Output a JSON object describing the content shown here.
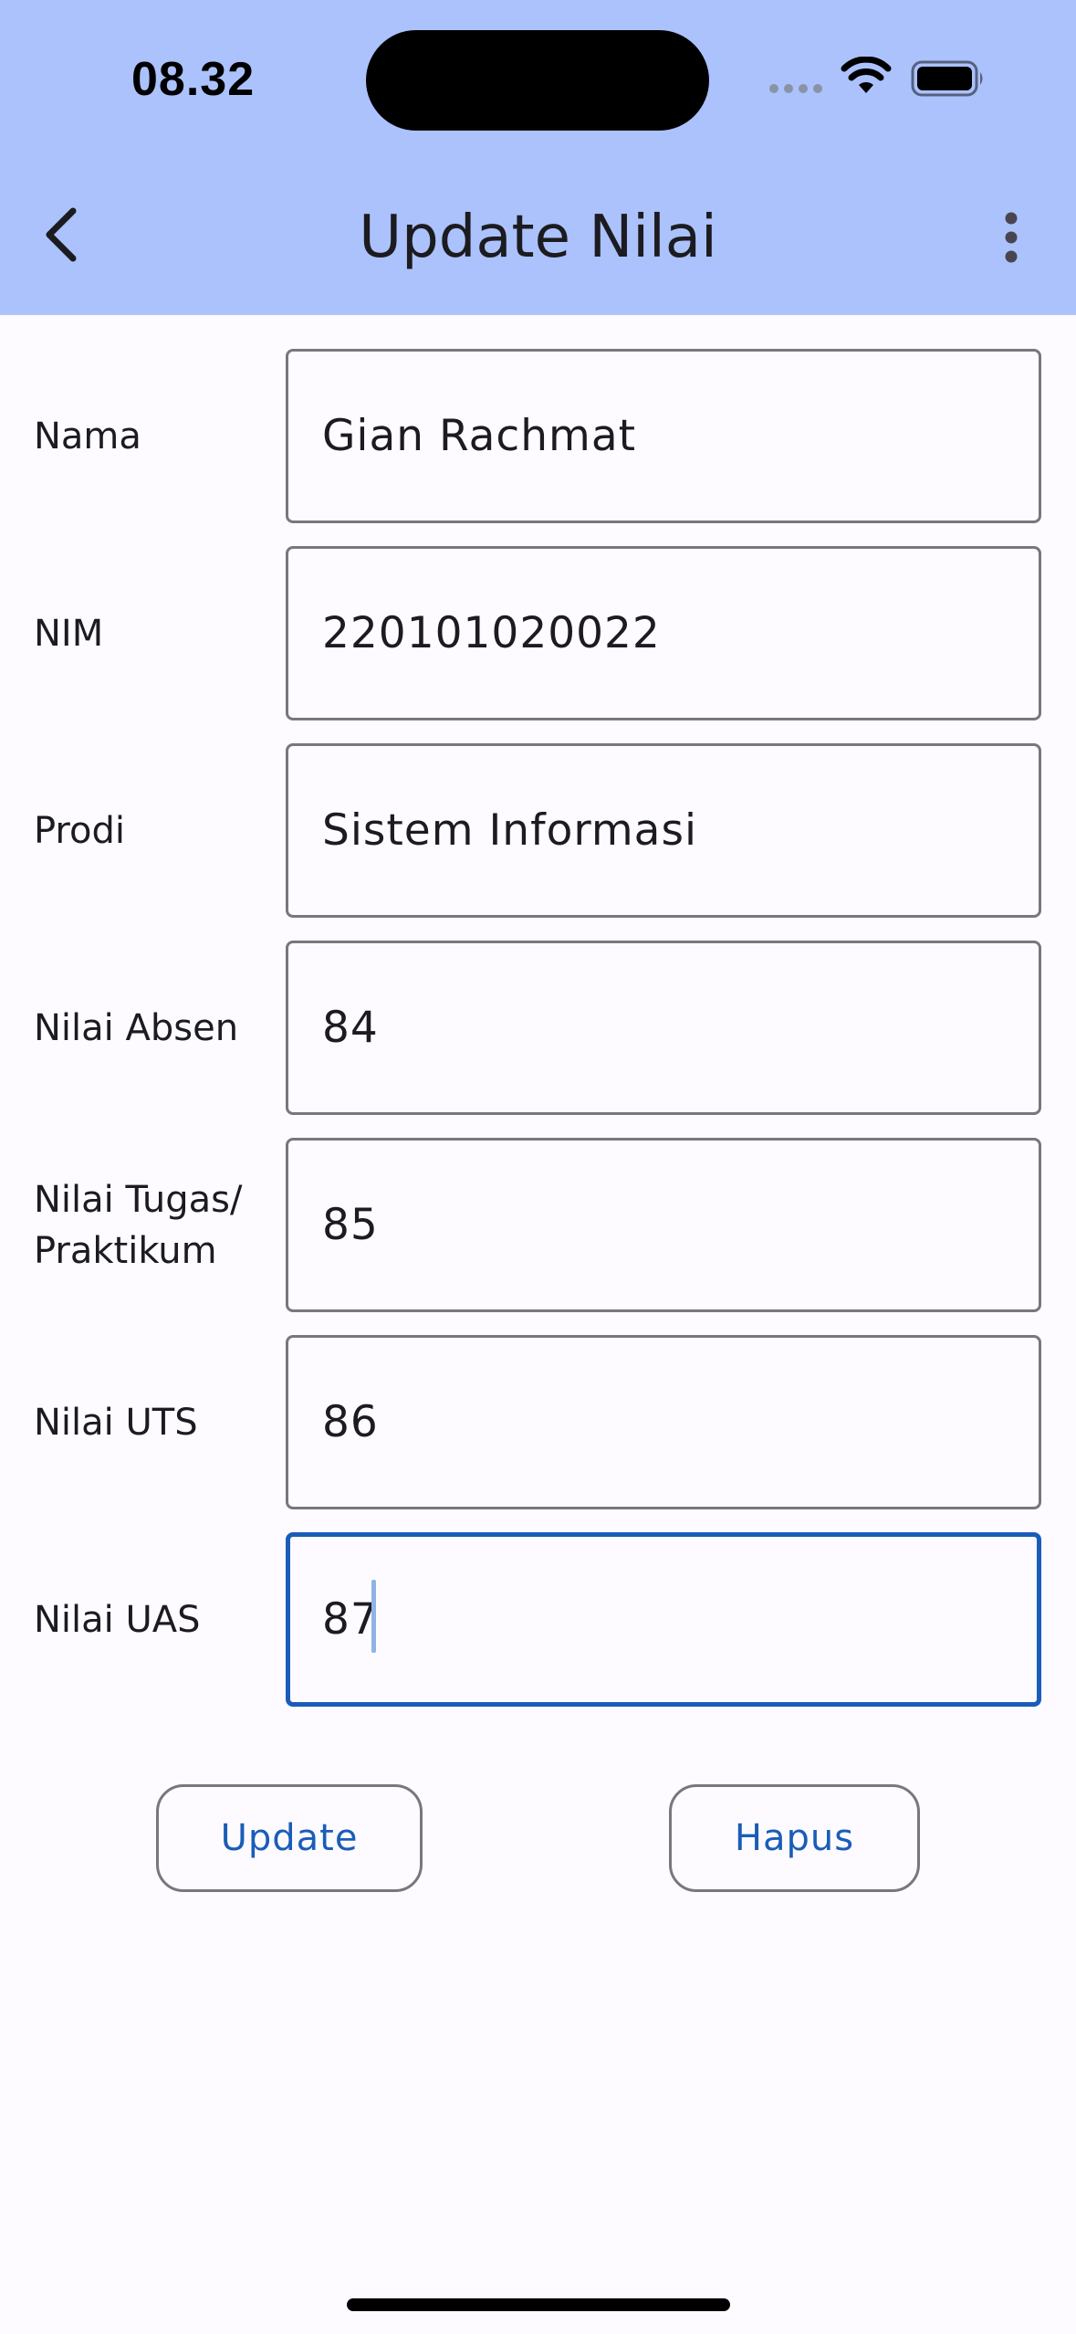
{
  "status_bar": {
    "time": "08.32",
    "icons": [
      "signal-dots-icon",
      "wifi-icon",
      "battery-icon"
    ]
  },
  "app_bar": {
    "title": "Update Nilai",
    "back_icon": "chevron-left-icon",
    "menu_icon": "more-vertical-icon",
    "background": "#ABC2FC"
  },
  "form": {
    "fields": [
      {
        "label": "Nama",
        "value": "Gian Rachmat"
      },
      {
        "label": "NIM",
        "value": "220101020022"
      },
      {
        "label": "Prodi",
        "value": "Sistem Informasi"
      },
      {
        "label": "Nilai Absen",
        "value": "84"
      },
      {
        "label": "Nilai Tugas/\nPraktikum",
        "value": "85"
      },
      {
        "label": "Nilai UTS",
        "value": "86"
      },
      {
        "label": "Nilai UAS",
        "value": "87"
      }
    ],
    "focused_field": "Nilai UAS"
  },
  "actions": {
    "update_label": "Update",
    "delete_label": "Hapus"
  },
  "colors": {
    "accent": "#1A5DB8",
    "outline": "#79767D",
    "background": "#FDFBFF"
  }
}
